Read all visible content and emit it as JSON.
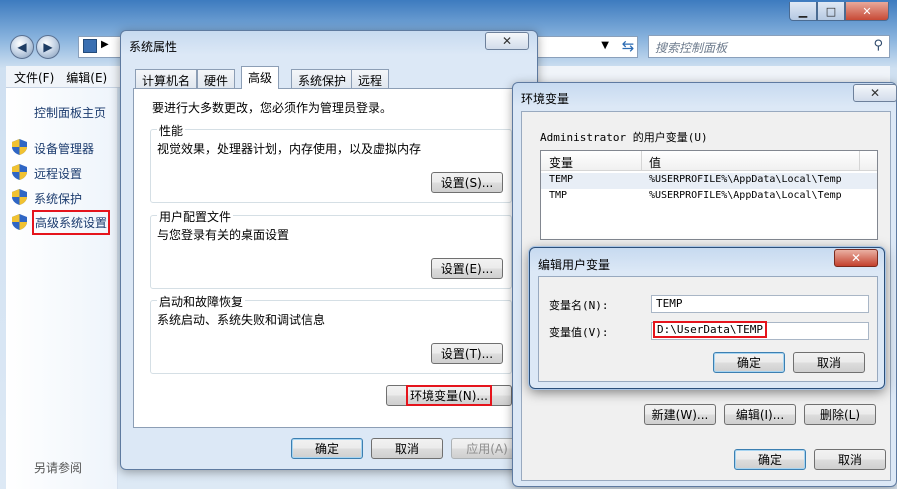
{
  "control_panel": {
    "search_placeholder": "搜索控制面板",
    "menu": [
      "文件(F)",
      "编辑(E)"
    ],
    "sidebar": {
      "home": "控制面板主页",
      "items": [
        "设备管理器",
        "远程设置",
        "系统保护",
        "高级系统设置"
      ],
      "see_also": "另请参阅"
    }
  },
  "system_properties": {
    "title": "系统属性",
    "tabs": [
      "计算机名",
      "硬件",
      "高级",
      "系统保护",
      "远程"
    ],
    "admin_note": "要进行大多数更改，您必须作为管理员登录。",
    "performance": {
      "label": "性能",
      "desc": "视觉效果，处理器计划，内存使用，以及虚拟内存",
      "button": "设置(S)..."
    },
    "user_profiles": {
      "label": "用户配置文件",
      "desc": "与您登录有关的桌面设置",
      "button": "设置(E)..."
    },
    "startup": {
      "label": "启动和故障恢复",
      "desc": "系统启动、系统失败和调试信息",
      "button": "设置(T)..."
    },
    "env_button": "环境变量(N)...",
    "ok": "确定",
    "cancel": "取消",
    "apply": "应用(A)"
  },
  "env_vars": {
    "title": "环境变量",
    "user_group": "Administrator 的用户变量(U)",
    "columns": [
      "变量",
      "值"
    ],
    "rows": [
      {
        "name": "TEMP",
        "value": "%USERPROFILE%\\AppData\\Local\\Temp"
      },
      {
        "name": "TMP",
        "value": "%USERPROFILE%\\AppData\\Local\\Temp"
      }
    ],
    "new": "新建(W)...",
    "edit": "编辑(I)...",
    "delete": "删除(L)",
    "ok": "确定",
    "cancel": "取消"
  },
  "edit_var": {
    "title": "编辑用户变量",
    "name_label": "变量名(N):",
    "name_value": "TEMP",
    "value_label": "变量值(V):",
    "value_value": "D:\\UserData\\TEMP",
    "ok": "确定",
    "cancel": "取消"
  },
  "colors": {
    "highlight_red": "#e5141c",
    "titlebar_blue": "#c7daf0"
  }
}
